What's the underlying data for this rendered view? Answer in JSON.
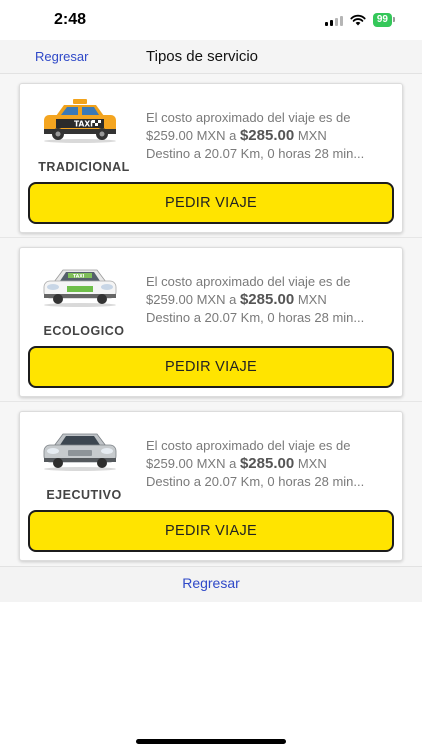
{
  "status": {
    "time": "2:48",
    "battery": "99"
  },
  "nav": {
    "back_label": "Regresar",
    "title": "Tipos de servicio"
  },
  "services": [
    {
      "name": "TRADICIONAL",
      "car_icon": "yellow-taxi-icon",
      "line1_prefix": "El costo aproximado del viaje es de",
      "price_low": "$259.00 MXN a",
      "price_high": "$285.00",
      "currency": "MXN",
      "destination": "Destino a 20.07 Km, 0 horas 28 min...",
      "button_label": "PEDIR VIAJE"
    },
    {
      "name": "ECOLOGICO",
      "car_icon": "eco-taxi-icon",
      "line1_prefix": "El costo aproximado del viaje es de",
      "price_low": "$259.00 MXN a",
      "price_high": "$285.00",
      "currency": "MXN",
      "destination": "Destino a 20.07 Km, 0 horas 28 min...",
      "button_label": "PEDIR VIAJE"
    },
    {
      "name": "EJECUTIVO",
      "car_icon": "executive-car-icon",
      "line1_prefix": "El costo aproximado del viaje es de",
      "price_low": "$259.00 MXN a",
      "price_high": "$285.00",
      "currency": "MXN",
      "destination": "Destino a 20.07 Km, 0 horas 28 min...",
      "button_label": "PEDIR VIAJE"
    }
  ],
  "bottom": {
    "back_label": "Regresar"
  },
  "colors": {
    "button_yellow": "#ffe400",
    "link_blue": "#2f49c8",
    "battery_green": "#34c759"
  }
}
